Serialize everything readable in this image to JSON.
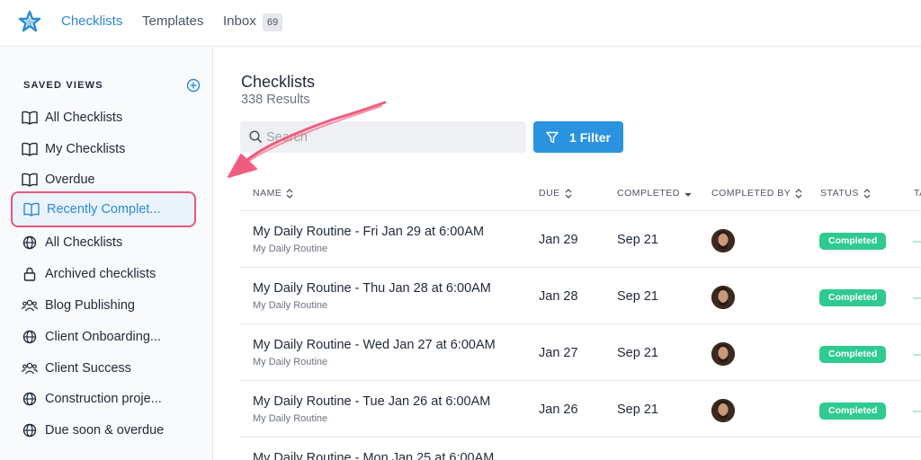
{
  "nav": {
    "checklists": "Checklists",
    "templates": "Templates",
    "inbox": "Inbox",
    "inbox_count": "69"
  },
  "sidebar": {
    "title": "SAVED VIEWS",
    "items": [
      {
        "label": "All Checklists",
        "icon": "book-icon"
      },
      {
        "label": "My Checklists",
        "icon": "book-icon"
      },
      {
        "label": "Overdue",
        "icon": "book-icon"
      },
      {
        "label": "Recently Complet...",
        "icon": "book-icon",
        "selected": true
      },
      {
        "label": "All Checklists",
        "icon": "globe-icon"
      },
      {
        "label": "Archived checklists",
        "icon": "lock-icon"
      },
      {
        "label": "Blog Publishing",
        "icon": "users-icon"
      },
      {
        "label": "Client Onboarding...",
        "icon": "globe-icon"
      },
      {
        "label": "Client Success",
        "icon": "users-icon"
      },
      {
        "label": "Construction proje...",
        "icon": "globe-icon"
      },
      {
        "label": "Due soon & overdue",
        "icon": "globe-icon"
      }
    ]
  },
  "main": {
    "title": "Checklists",
    "results": "338 Results",
    "search_placeholder": "Search",
    "filter_label": "1 Filter",
    "columns": [
      "NAME",
      "DUE",
      "COMPLETED",
      "COMPLETED BY",
      "STATUS",
      "TA"
    ],
    "rows": [
      {
        "name": "My Daily Routine - Fri Jan 29 at 6:00AM",
        "template": "My Daily Routine",
        "due": "Jan 29",
        "completed": "Sep 21",
        "status": "Completed"
      },
      {
        "name": "My Daily Routine - Thu Jan 28 at 6:00AM",
        "template": "My Daily Routine",
        "due": "Jan 28",
        "completed": "Sep 21",
        "status": "Completed"
      },
      {
        "name": "My Daily Routine - Wed Jan 27 at 6:00AM",
        "template": "My Daily Routine",
        "due": "Jan 27",
        "completed": "Sep 21",
        "status": "Completed"
      },
      {
        "name": "My Daily Routine - Tue Jan 26 at 6:00AM",
        "template": "My Daily Routine",
        "due": "Jan 26",
        "completed": "Sep 21",
        "status": "Completed"
      },
      {
        "name": "My Daily Routine - Mon Jan 25 at 6:00AM",
        "template": "",
        "due": "",
        "completed": "",
        "status": ""
      }
    ]
  },
  "colors": {
    "accent": "#2a8ad4",
    "button": "#2a93e0",
    "status_completed": "#2fca8f",
    "highlight_border": "#e8577a"
  }
}
